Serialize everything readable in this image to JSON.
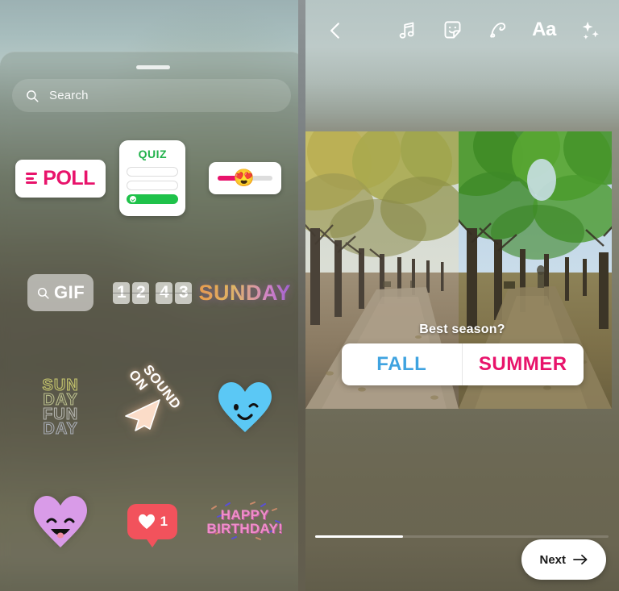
{
  "left_panel": {
    "sheet": {
      "grabber": "drag-handle",
      "search": {
        "placeholder": "Search",
        "icon": "search-icon",
        "value": ""
      }
    },
    "stickers": [
      {
        "id": "poll",
        "type": "poll-sticker",
        "label": "POLL",
        "icon": "poll-bars-icon",
        "color": "#E8136B"
      },
      {
        "id": "quiz",
        "type": "quiz-sticker",
        "label": "QUIZ",
        "color": "#21B24B",
        "rows": 3,
        "selected_row": 3
      },
      {
        "id": "emoji-slider",
        "type": "emoji-slider-sticker",
        "emoji": "😍",
        "fill_percent": 41,
        "color": "#E8136B"
      },
      {
        "id": "gif",
        "type": "gif-button",
        "label": "GIF",
        "icon": "search-icon"
      },
      {
        "id": "countdown",
        "type": "countdown-sticker",
        "digits": [
          "1",
          "2",
          "4",
          "3"
        ]
      },
      {
        "id": "sunday",
        "type": "text-sticker",
        "label": "SUNDAY"
      },
      {
        "id": "sunday-funday",
        "type": "outline-text-sticker",
        "lines": [
          "SUN",
          "DAY",
          "FUN",
          "DAY"
        ]
      },
      {
        "id": "sound-on",
        "type": "sound-on-sticker",
        "line1": "SOUND",
        "line2": "ON"
      },
      {
        "id": "blue-heart",
        "type": "heart-sticker",
        "color": "#5BC8F5",
        "face": "wink"
      },
      {
        "id": "purple-heart",
        "type": "heart-sticker",
        "color": "#D99BE8",
        "face": "smile"
      },
      {
        "id": "like-count",
        "type": "like-bubble-sticker",
        "count": "1",
        "color": "#F2525C",
        "icon": "heart-icon"
      },
      {
        "id": "happy-birthday",
        "type": "text-sticker",
        "line1": "HAPPY",
        "line2": "BIRTHDAY!",
        "color": "#EE8EC8"
      }
    ]
  },
  "right_panel": {
    "toolbar": {
      "back": "chevron-left-icon",
      "items": [
        {
          "name": "music-note-icon",
          "label": ""
        },
        {
          "name": "sticker-face-icon",
          "label": ""
        },
        {
          "name": "draw-squiggle-icon",
          "label": ""
        },
        {
          "name": "text-aa-icon",
          "label": "Aa"
        },
        {
          "name": "sparkles-icon",
          "label": ""
        }
      ]
    },
    "story": {
      "image_alt": "tree-lined avenue split between autumn and summer",
      "poll": {
        "question": "Best season?",
        "options": [
          {
            "label": "FALL",
            "color": "#3FA3E0"
          },
          {
            "label": "SUMMER",
            "color": "#E8136B"
          }
        ]
      }
    },
    "progress_percent": "30",
    "next_button": {
      "label": "Next",
      "icon": "arrow-right-icon"
    }
  }
}
